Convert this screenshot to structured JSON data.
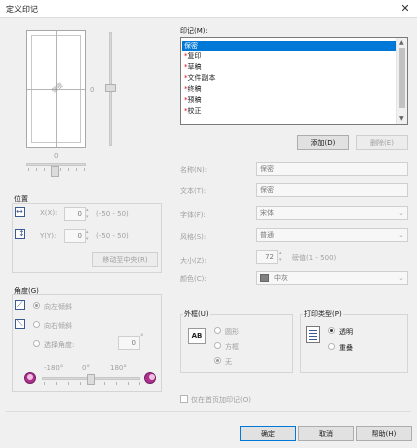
{
  "window": {
    "title": "定义印记",
    "close_glyph": "✕"
  },
  "preview": {
    "watermark_text": "保密",
    "slider_value": "0",
    "hslider_value": "0"
  },
  "stamp_list": {
    "label": "印记(M):",
    "items": [
      {
        "text": "保密",
        "star": "",
        "selected": true
      },
      {
        "text": "复印",
        "star": "*"
      },
      {
        "text": "草稿",
        "star": "*"
      },
      {
        "text": "文件副本",
        "star": "*"
      },
      {
        "text": "终稿",
        "star": "*"
      },
      {
        "text": "预稿",
        "star": "*"
      },
      {
        "text": "校正",
        "star": "*"
      }
    ]
  },
  "buttons": {
    "add": "添加(D)",
    "delete": "删除(E)",
    "center": "移动至中央(R)",
    "ok": "确定",
    "cancel": "取消",
    "help": "帮助(H)"
  },
  "position": {
    "group_label": "位置",
    "x_label": "X(X):",
    "x_value": "0",
    "x_range": "(-50 - 50)",
    "y_label": "Y(Y):",
    "y_value": "0",
    "y_range": "(-50 - 50)"
  },
  "angle": {
    "group_label": "角度(G)",
    "opt_left": "向左倾斜",
    "opt_right": "向右倾斜",
    "opt_custom": "选择角度:",
    "custom_value": "0",
    "degree_sign": "°",
    "tick_min": "-180°",
    "tick_mid": "0°",
    "tick_max": "180°"
  },
  "properties": {
    "name_label": "名称(N):",
    "name_value": "保密",
    "text_label": "文本(T):",
    "text_value": "保密",
    "font_label": "字体(F):",
    "font_value": "宋体",
    "style_label": "风格(S):",
    "style_value": "普通",
    "size_label": "大小(Z):",
    "size_value": "72",
    "size_unit": "磅值(1 - 500)",
    "color_label": "颜色(C):",
    "color_value": "中灰",
    "color_swatch": "#808080"
  },
  "border": {
    "group_label": "外框(U)",
    "icon_text": "AB",
    "opt_circle": "圆形",
    "opt_square": "方框",
    "opt_none": "无"
  },
  "print_type": {
    "group_label": "打印类型(P)",
    "opt_transparent": "透明",
    "opt_overlay": "重叠"
  },
  "first_page_only": {
    "label": "仅在首页加印记(O)"
  }
}
